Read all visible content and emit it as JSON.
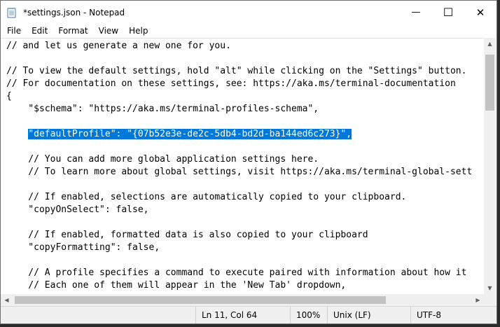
{
  "window": {
    "title": "*settings.json - Notepad",
    "minimize_glyph": "—",
    "maximize_glyph": "☐",
    "close_glyph": "✕"
  },
  "menu": [
    "File",
    "Edit",
    "Format",
    "View",
    "Help"
  ],
  "editor": {
    "lines": [
      "// and let us generate a new one for you.",
      "",
      "// To view the default settings, hold \"alt\" while clicking on the \"Settings\" button.",
      "// For documentation on these settings, see: https://aka.ms/terminal-documentation",
      "{",
      "    \"$schema\": \"https://aka.ms/terminal-profiles-schema\",",
      "",
      "    \"defaultProfile\": \"{07b52e3e-de2c-5db4-bd2d-ba144ed6c273}\",",
      "",
      "    // You can add more global application settings here.",
      "    // To learn more about global settings, visit https://aka.ms/terminal-global-sett",
      "",
      "    // If enabled, selections are automatically copied to your clipboard.",
      "    \"copyOnSelect\": false,",
      "",
      "    // If enabled, formatted data is also copied to your clipboard",
      "    \"copyFormatting\": false,",
      "",
      "    // A profile specifies a command to execute paired with information about how it",
      "    // Each one of them will appear in the 'New Tab' dropdown,"
    ],
    "selected_line_index": 7,
    "selected_indent": "    ",
    "selected_text": "\"defaultProfile\": \"{07b52e3e-de2c-5db4-bd2d-ba144ed6c273}\","
  },
  "status": {
    "position": "Ln 11, Col 64",
    "zoom": "100%",
    "line_ending": "Unix (LF)",
    "encoding": "UTF-8"
  },
  "colors": {
    "selection": "#0078d7",
    "scrollbar": "#f0f0f0",
    "thumb": "#c2c2c2"
  }
}
